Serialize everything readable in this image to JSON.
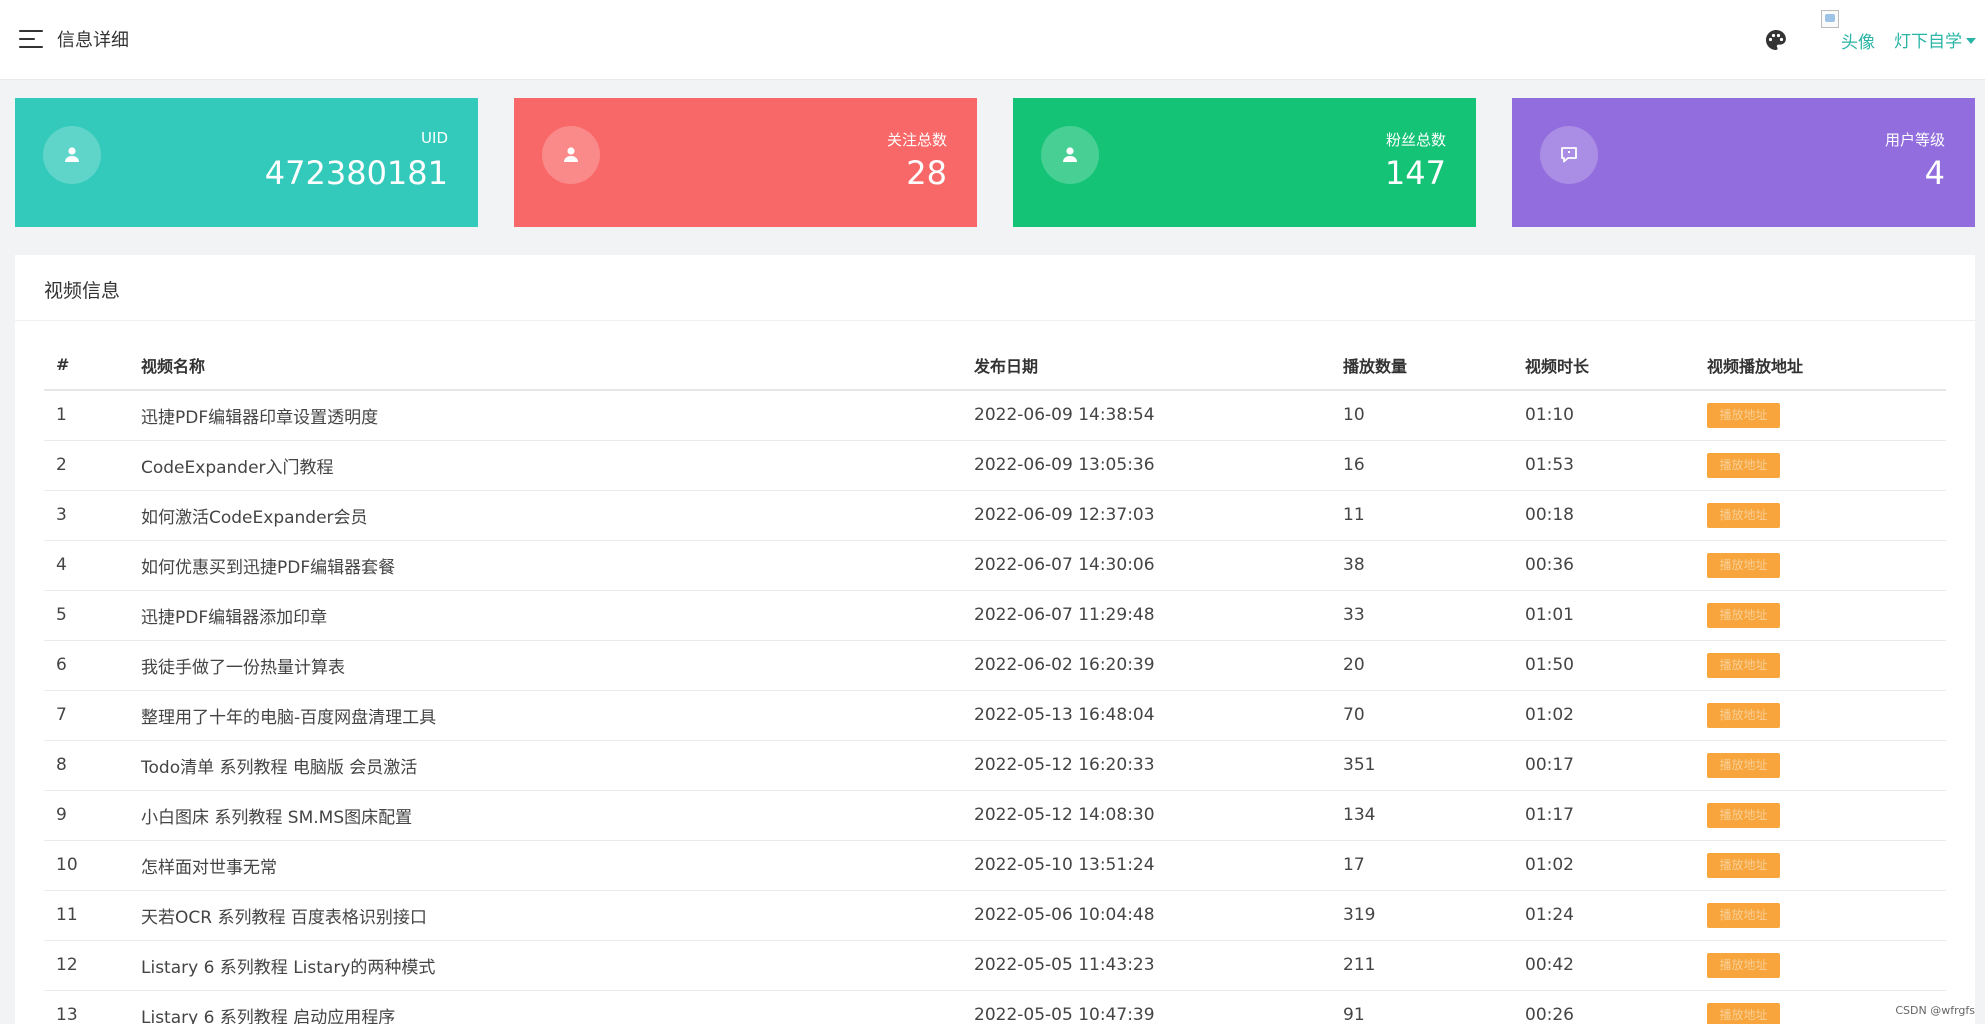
{
  "header": {
    "title": "信息详细",
    "avatar_alt": "头像",
    "user_name": "灯下自学"
  },
  "stats": [
    {
      "label": "UID",
      "value": "472380181",
      "color": "#33cabb",
      "icon": "user-icon"
    },
    {
      "label": "关注总数",
      "value": "28",
      "color": "#f96868",
      "icon": "user-icon"
    },
    {
      "label": "粉丝总数",
      "value": "147",
      "color": "#15c377",
      "icon": "user-icon"
    },
    {
      "label": "用户等级",
      "value": "4",
      "color": "#926dde",
      "icon": "message-icon"
    }
  ],
  "panel": {
    "title": "视频信息",
    "columns": [
      "#",
      "视频名称",
      "发布日期",
      "播放数量",
      "视频时长",
      "视频播放地址"
    ],
    "rows": [
      {
        "no": "1",
        "name": "迅捷PDF编辑器印章设置透明度",
        "date": "2022-06-09 14:38:54",
        "plays": "10",
        "duration": "01:10",
        "link": "播放地址"
      },
      {
        "no": "2",
        "name": "CodeExpander入门教程",
        "date": "2022-06-09 13:05:36",
        "plays": "16",
        "duration": "01:53",
        "link": "播放地址"
      },
      {
        "no": "3",
        "name": "如何激活CodeExpander会员",
        "date": "2022-06-09 12:37:03",
        "plays": "11",
        "duration": "00:18",
        "link": "播放地址"
      },
      {
        "no": "4",
        "name": "如何优惠买到迅捷PDF编辑器套餐",
        "date": "2022-06-07 14:30:06",
        "plays": "38",
        "duration": "00:36",
        "link": "播放地址"
      },
      {
        "no": "5",
        "name": "迅捷PDF编辑器添加印章",
        "date": "2022-06-07 11:29:48",
        "plays": "33",
        "duration": "01:01",
        "link": "播放地址"
      },
      {
        "no": "6",
        "name": "我徒手做了一份热量计算表",
        "date": "2022-06-02 16:20:39",
        "plays": "20",
        "duration": "01:50",
        "link": "播放地址"
      },
      {
        "no": "7",
        "name": "整理用了十年的电脑-百度网盘清理工具",
        "date": "2022-05-13 16:48:04",
        "plays": "70",
        "duration": "01:02",
        "link": "播放地址"
      },
      {
        "no": "8",
        "name": "Todo清单 系列教程 电脑版 会员激活",
        "date": "2022-05-12 16:20:33",
        "plays": "351",
        "duration": "00:17",
        "link": "播放地址"
      },
      {
        "no": "9",
        "name": "小白图床 系列教程 SM.MS图床配置",
        "date": "2022-05-12 14:08:30",
        "plays": "134",
        "duration": "01:17",
        "link": "播放地址"
      },
      {
        "no": "10",
        "name": "怎样面对世事无常",
        "date": "2022-05-10 13:51:24",
        "plays": "17",
        "duration": "01:02",
        "link": "播放地址"
      },
      {
        "no": "11",
        "name": "天若OCR 系列教程 百度表格识别接口",
        "date": "2022-05-06 10:04:48",
        "plays": "319",
        "duration": "01:24",
        "link": "播放地址"
      },
      {
        "no": "12",
        "name": "Listary 6 系列教程 Listary的两种模式",
        "date": "2022-05-05 11:43:23",
        "plays": "211",
        "duration": "00:42",
        "link": "播放地址"
      },
      {
        "no": "13",
        "name": "Listary 6 系列教程 启动应用程序",
        "date": "2022-05-05 10:47:39",
        "plays": "91",
        "duration": "00:26",
        "link": "播放地址"
      }
    ]
  },
  "watermark": "CSDN @wfrgfs"
}
